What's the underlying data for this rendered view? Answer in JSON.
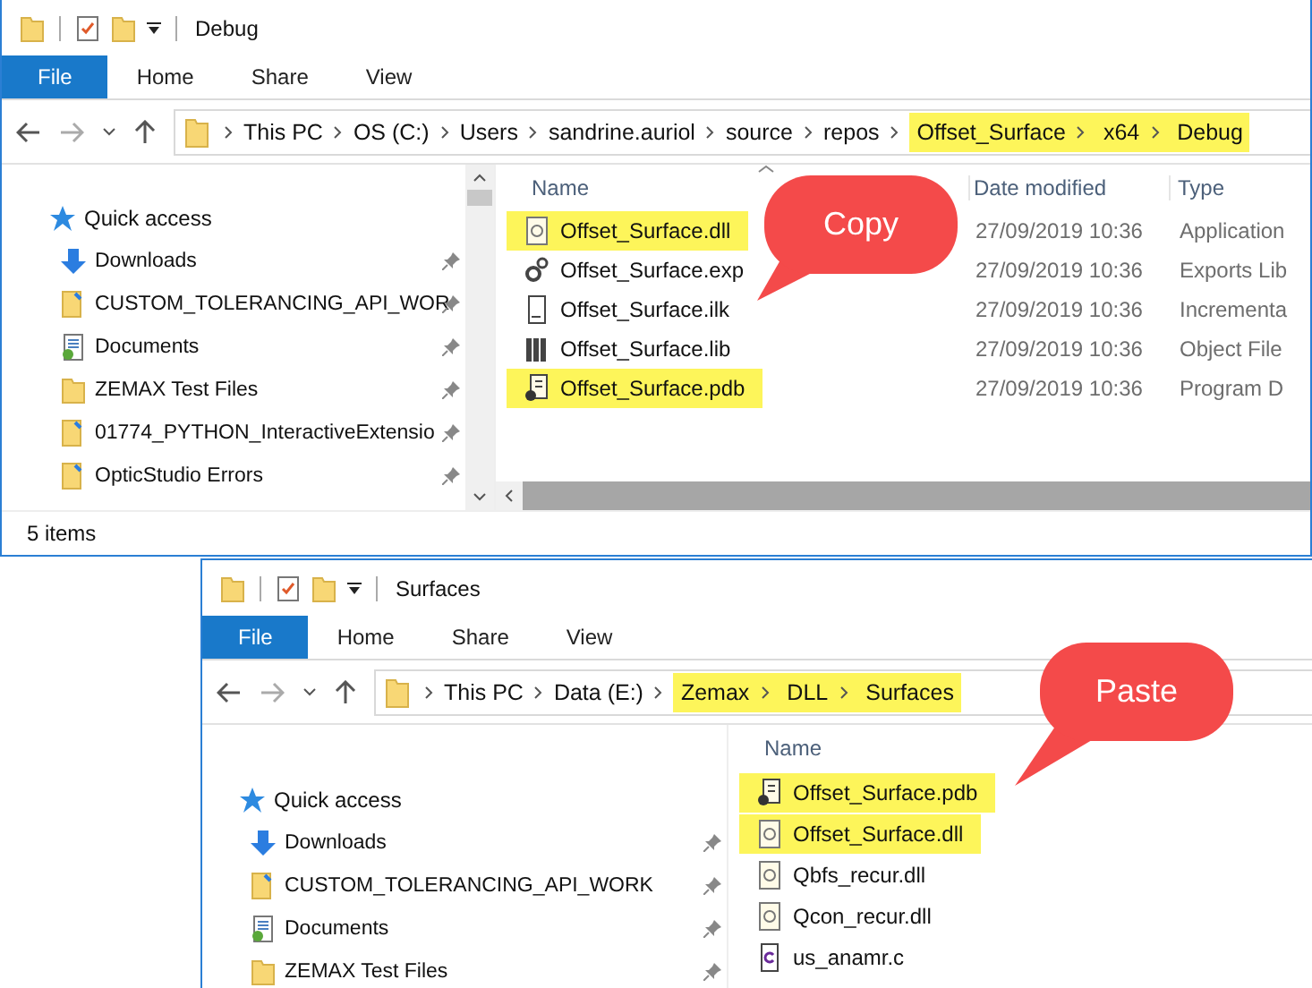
{
  "windows": [
    {
      "title": "Debug",
      "tabs": [
        {
          "label": "File",
          "selected": true
        },
        {
          "label": "Home",
          "selected": false
        },
        {
          "label": "Share",
          "selected": false
        },
        {
          "label": "View",
          "selected": false
        }
      ],
      "path": [
        {
          "label": "This PC",
          "highlighted": false
        },
        {
          "label": "OS (C:)",
          "highlighted": false
        },
        {
          "label": "Users",
          "highlighted": false
        },
        {
          "label": "sandrine.auriol",
          "highlighted": false
        },
        {
          "label": "source",
          "highlighted": false
        },
        {
          "label": "repos",
          "highlighted": false
        },
        {
          "label": "Offset_Surface",
          "highlighted": true
        },
        {
          "label": "x64",
          "highlighted": true
        },
        {
          "label": "Debug",
          "highlighted": true
        }
      ],
      "sidebar": [
        {
          "label": "Quick access",
          "kind": "quick",
          "pinned": false
        },
        {
          "label": "Downloads",
          "kind": "downloads",
          "pinned": true
        },
        {
          "label": "CUSTOM_TOLERANCING_API_WOR",
          "kind": "shared",
          "pinned": true
        },
        {
          "label": "Documents",
          "kind": "documents",
          "pinned": true
        },
        {
          "label": "ZEMAX Test Files",
          "kind": "folder",
          "pinned": true
        },
        {
          "label": "01774_PYTHON_InteractiveExtensio",
          "kind": "shared",
          "pinned": true
        },
        {
          "label": "OpticStudio Errors",
          "kind": "shared",
          "pinned": true
        }
      ],
      "columns": [
        "Name",
        "Date modified",
        "Type"
      ],
      "files": [
        {
          "name": "Offset_Surface.dll",
          "kind": "dll",
          "date": "27/09/2019 10:36",
          "type": "Application",
          "highlighted": true
        },
        {
          "name": "Offset_Surface.exp",
          "kind": "exp",
          "date": "27/09/2019 10:36",
          "type": "Exports Lib",
          "highlighted": false
        },
        {
          "name": "Offset_Surface.ilk",
          "kind": "ilk",
          "date": "27/09/2019 10:36",
          "type": "Incrementa",
          "highlighted": false
        },
        {
          "name": "Offset_Surface.lib",
          "kind": "lib",
          "date": "27/09/2019 10:36",
          "type": "Object File",
          "highlighted": false
        },
        {
          "name": "Offset_Surface.pdb",
          "kind": "pdb",
          "date": "27/09/2019 10:36",
          "type": "Program D",
          "highlighted": true
        }
      ],
      "status": "5 items",
      "callout": "Copy"
    },
    {
      "title": "Surfaces",
      "tabs": [
        {
          "label": "File",
          "selected": true
        },
        {
          "label": "Home",
          "selected": false
        },
        {
          "label": "Share",
          "selected": false
        },
        {
          "label": "View",
          "selected": false
        }
      ],
      "path": [
        {
          "label": "This PC",
          "highlighted": false
        },
        {
          "label": "Data (E:)",
          "highlighted": false
        },
        {
          "label": "Zemax",
          "highlighted": true
        },
        {
          "label": "DLL",
          "highlighted": true
        },
        {
          "label": "Surfaces",
          "highlighted": true
        }
      ],
      "sidebar": [
        {
          "label": "Quick access",
          "kind": "quick",
          "pinned": false
        },
        {
          "label": "Downloads",
          "kind": "downloads",
          "pinned": true
        },
        {
          "label": "CUSTOM_TOLERANCING_API_WORK",
          "kind": "shared",
          "pinned": true
        },
        {
          "label": "Documents",
          "kind": "documents",
          "pinned": true
        },
        {
          "label": "ZEMAX Test Files",
          "kind": "folder",
          "pinned": true
        }
      ],
      "columns": [
        "Name"
      ],
      "files": [
        {
          "name": "Offset_Surface.pdb",
          "kind": "pdb",
          "highlighted": true
        },
        {
          "name": "Offset_Surface.dll",
          "kind": "dll",
          "highlighted": true
        },
        {
          "name": "Qbfs_recur.dll",
          "kind": "dll",
          "highlighted": false
        },
        {
          "name": "Qcon_recur.dll",
          "kind": "dll",
          "highlighted": false
        },
        {
          "name": "us_anamr.c",
          "kind": "c",
          "highlighted": false
        }
      ],
      "callout": "Paste"
    }
  ]
}
